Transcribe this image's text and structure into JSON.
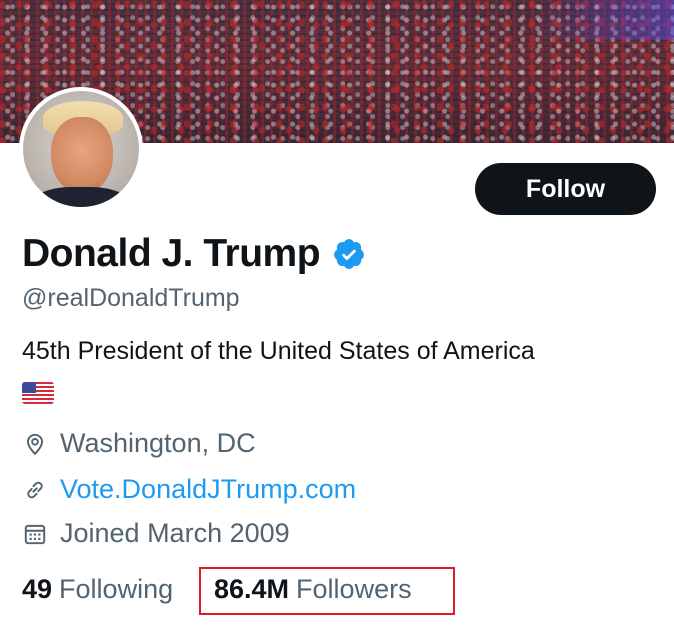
{
  "profile": {
    "name": "Donald J. Trump",
    "handle": "@realDonaldTrump",
    "bio": "45th President of the United States of America",
    "flag_icon": "us-flag-emoji",
    "location": "Washington, DC",
    "website": "Vote.DonaldJTrump.com",
    "joined": "Joined March 2009",
    "verified": true
  },
  "actions": {
    "follow_label": "Follow"
  },
  "stats": {
    "following_count": "49",
    "following_label": "Following",
    "followers_count": "86.4M",
    "followers_label": "Followers"
  },
  "icons": {
    "location": "location-pin-icon",
    "website": "link-icon",
    "joined": "calendar-icon",
    "verified": "verified-badge-icon"
  },
  "colors": {
    "accent": "#1d9bf0",
    "text_primary": "#0f1419",
    "text_secondary": "#536471",
    "button_bg": "#0f1419",
    "highlight_box": "#d62027"
  }
}
